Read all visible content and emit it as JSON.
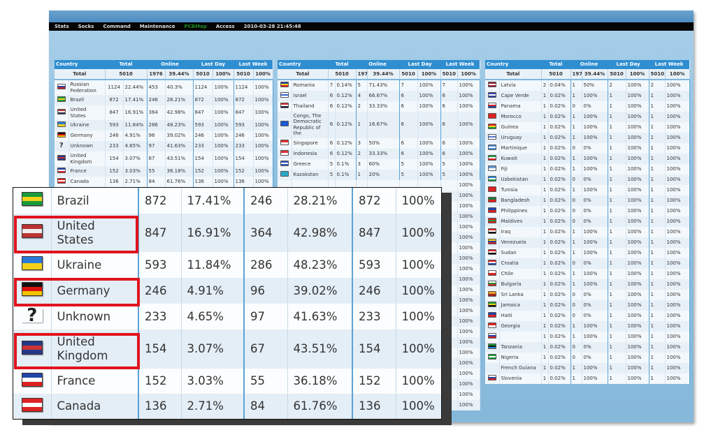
{
  "nav": {
    "items": [
      "Stats",
      "Socks",
      "Command",
      "Maintenance",
      "PCBMap",
      "Access"
    ],
    "active": "PCBMap",
    "datetime": "2010-03-28 21:45:48"
  },
  "headers": {
    "country": "Country",
    "total": "Total",
    "online": "Online",
    "last_day": "Last Day",
    "last_week": "Last Week"
  },
  "totals": {
    "label": "Total",
    "total": "5010",
    "online": "1976",
    "online_pct": "39.44%",
    "last_day": "5010",
    "last_day_pct": "100%",
    "last_week": "5010",
    "last_week_pct": "100%"
  },
  "colors": {
    "accent": "#2f8ed0",
    "highlight": "#e0141e",
    "active_nav": "#1d8a1d"
  },
  "tables": [
    [
      {
        "name": "Russian Federation",
        "flag": [
          "#fff",
          "#2244aa",
          "#cc2222"
        ],
        "v": [
          "1124",
          "22.44%",
          "453",
          "40.3%",
          "1124",
          "100%",
          "1124",
          "100%"
        ]
      },
      {
        "name": "Brazil",
        "flag": [
          "#1a9a3a",
          "#f2d21a",
          "#1a9a3a"
        ],
        "v": [
          "872",
          "17.41%",
          "246",
          "28.21%",
          "872",
          "100%",
          "872",
          "100%"
        ]
      },
      {
        "name": "United States",
        "flag": [
          "#b33",
          "#eee",
          "#335"
        ],
        "v": [
          "847",
          "16.91%",
          "364",
          "42.98%",
          "847",
          "100%",
          "847",
          "100%"
        ]
      },
      {
        "name": "Ukraine",
        "flag": [
          "#2a7bd8",
          "#f5d21a"
        ],
        "v": [
          "593",
          "11.84%",
          "286",
          "48.23%",
          "593",
          "100%",
          "593",
          "100%"
        ]
      },
      {
        "name": "Germany",
        "flag": [
          "#111",
          "#d11",
          "#f5c400"
        ],
        "v": [
          "246",
          "4.91%",
          "96",
          "39.02%",
          "246",
          "100%",
          "246",
          "100%"
        ]
      },
      {
        "name": "Unknown",
        "flag": null,
        "v": [
          "233",
          "4.65%",
          "97",
          "41.63%",
          "233",
          "100%",
          "233",
          "100%"
        ]
      },
      {
        "name": "United Kingdom",
        "flag": [
          "#233a8a",
          "#c33",
          "#233a8a"
        ],
        "v": [
          "154",
          "3.07%",
          "67",
          "43.51%",
          "154",
          "100%",
          "154",
          "100%"
        ]
      },
      {
        "name": "France",
        "flag": [
          "#2244aa",
          "#fff",
          "#d22"
        ],
        "v": [
          "152",
          "3.03%",
          "55",
          "36.18%",
          "152",
          "100%",
          "152",
          "100%"
        ]
      },
      {
        "name": "Canada",
        "flag": [
          "#d22",
          "#fff",
          "#d22"
        ],
        "v": [
          "136",
          "2.71%",
          "84",
          "61.76%",
          "136",
          "100%",
          "136",
          "100%"
        ]
      }
    ],
    [
      {
        "name": "Romania",
        "flag": [
          "#2244aa",
          "#f5d21a",
          "#d22"
        ],
        "v": [
          "7",
          "0.14%",
          "5",
          "71.43%",
          "7",
          "100%",
          "7",
          "100%"
        ]
      },
      {
        "name": "Israel",
        "flag": [
          "#fff",
          "#3366cc",
          "#fff"
        ],
        "v": [
          "6",
          "0.12%",
          "4",
          "66.67%",
          "6",
          "100%",
          "6",
          "100%"
        ]
      },
      {
        "name": "Thailand",
        "flag": [
          "#c33",
          "#fff",
          "#224"
        ],
        "v": [
          "6",
          "0.12%",
          "2",
          "33.33%",
          "6",
          "100%",
          "6",
          "100%"
        ]
      },
      {
        "name": "Congo, The Democratic Republic of the",
        "flag": [
          "#1a5ad8",
          "#1a5ad8"
        ],
        "v": [
          "6",
          "0.12%",
          "1",
          "16.67%",
          "6",
          "100%",
          "6",
          "100%"
        ]
      },
      {
        "name": "Singapore",
        "flag": [
          "#d33",
          "#fff"
        ],
        "v": [
          "6",
          "0.12%",
          "3",
          "50%",
          "6",
          "100%",
          "6",
          "100%"
        ]
      },
      {
        "name": "Indonesia",
        "flag": [
          "#d33",
          "#fff"
        ],
        "v": [
          "6",
          "0.12%",
          "2",
          "33.33%",
          "6",
          "100%",
          "6",
          "100%"
        ]
      },
      {
        "name": "Greece",
        "flag": [
          "#3355bb",
          "#fff",
          "#3355bb"
        ],
        "v": [
          "5",
          "0.1%",
          "3",
          "60%",
          "5",
          "100%",
          "5",
          "100%"
        ]
      },
      {
        "name": "Kazakstan",
        "flag": [
          "#2aa8c8",
          "#2aa8c8"
        ],
        "v": [
          "5",
          "0.1%",
          "1",
          "20%",
          "5",
          "100%",
          "5",
          "100%"
        ]
      }
    ],
    [
      {
        "name": "Latvia",
        "flag": [
          "#9a2233",
          "#fff",
          "#9a2233"
        ],
        "v": [
          "2",
          "0.04%",
          "1",
          "50%",
          "2",
          "100%",
          "2",
          "100%"
        ]
      },
      {
        "name": "Cape Verde",
        "flag": [
          "#3344aa",
          "#fff",
          "#3344aa"
        ],
        "v": [
          "1",
          "0.02%",
          "1",
          "100%",
          "1",
          "100%",
          "1",
          "100%"
        ]
      },
      {
        "name": "Panama",
        "flag": [
          "#fff",
          "#d22",
          "#2244aa"
        ],
        "v": [
          "1",
          "0.02%",
          "0",
          "0%",
          "1",
          "100%",
          "1",
          "100%"
        ]
      },
      {
        "name": "Morocco",
        "flag": [
          "#d22",
          "#d22"
        ],
        "v": [
          "1",
          "0.02%",
          "1",
          "100%",
          "1",
          "100%",
          "1",
          "100%"
        ]
      },
      {
        "name": "Guinea",
        "flag": [
          "#d22",
          "#f5d21a",
          "#1a9a3a"
        ],
        "v": [
          "1",
          "0.02%",
          "1",
          "100%",
          "1",
          "100%",
          "1",
          "100%"
        ]
      },
      {
        "name": "Uruguay",
        "flag": [
          "#fff",
          "#5577cc",
          "#fff"
        ],
        "v": [
          "1",
          "0.02%",
          "1",
          "100%",
          "1",
          "100%",
          "1",
          "100%"
        ]
      },
      {
        "name": "Martinique",
        "flag": [
          "#4a8ad8",
          "#fff",
          "#4a8ad8"
        ],
        "v": [
          "1",
          "0.02%",
          "0",
          "0%",
          "1",
          "100%",
          "1",
          "100%"
        ]
      },
      {
        "name": "Kuwait",
        "flag": [
          "#1a9a3a",
          "#fff",
          "#d22"
        ],
        "v": [
          "1",
          "0.02%",
          "1",
          "100%",
          "1",
          "100%",
          "1",
          "100%"
        ]
      },
      {
        "name": "Fiji",
        "flag": [
          "#6a9ad8",
          "#fff"
        ],
        "v": [
          "1",
          "0.02%",
          "1",
          "100%",
          "1",
          "100%",
          "1",
          "100%"
        ]
      },
      {
        "name": "Uzbekistan",
        "flag": [
          "#2a8ad8",
          "#fff",
          "#1a9a3a"
        ],
        "v": [
          "1",
          "0.02%",
          "0",
          "0%",
          "1",
          "100%",
          "1",
          "100%"
        ]
      },
      {
        "name": "Tunisia",
        "flag": [
          "#d22",
          "#d22"
        ],
        "v": [
          "1",
          "0.02%",
          "1",
          "100%",
          "1",
          "100%",
          "1",
          "100%"
        ]
      },
      {
        "name": "Bangladesh",
        "flag": [
          "#1a7a3a",
          "#d22"
        ],
        "v": [
          "1",
          "0.02%",
          "0",
          "0%",
          "1",
          "100%",
          "1",
          "100%"
        ]
      },
      {
        "name": "Philippines",
        "flag": [
          "#2244aa",
          "#d22"
        ],
        "v": [
          "1",
          "0.02%",
          "0",
          "0%",
          "1",
          "100%",
          "1",
          "100%"
        ]
      },
      {
        "name": "Maldives",
        "flag": [
          "#d22",
          "#1a9a3a",
          "#d22"
        ],
        "v": [
          "1",
          "0.02%",
          "0",
          "0%",
          "1",
          "100%",
          "1",
          "100%"
        ]
      },
      {
        "name": "Iraq",
        "flag": [
          "#d22",
          "#fff",
          "#111"
        ],
        "v": [
          "1",
          "0.02%",
          "1",
          "100%",
          "1",
          "100%",
          "1",
          "100%"
        ]
      },
      {
        "name": "Venezuela",
        "flag": [
          "#f5d21a",
          "#2244aa",
          "#d22"
        ],
        "v": [
          "1",
          "0.02%",
          "1",
          "100%",
          "1",
          "100%",
          "1",
          "100%"
        ]
      },
      {
        "name": "Sudan",
        "flag": [
          "#d22",
          "#fff",
          "#111"
        ],
        "v": [
          "1",
          "0.02%",
          "1",
          "100%",
          "1",
          "100%",
          "1",
          "100%"
        ]
      },
      {
        "name": "Croatia",
        "flag": [
          "#d22",
          "#fff",
          "#2244aa"
        ],
        "v": [
          "1",
          "0.02%",
          "0",
          "0%",
          "1",
          "100%",
          "1",
          "100%"
        ]
      },
      {
        "name": "Chile",
        "flag": [
          "#fff",
          "#d22"
        ],
        "v": [
          "1",
          "0.02%",
          "1",
          "100%",
          "1",
          "100%",
          "1",
          "100%"
        ]
      },
      {
        "name": "Bulgaria",
        "flag": [
          "#fff",
          "#1a9a3a",
          "#d22"
        ],
        "v": [
          "1",
          "0.02%",
          "1",
          "100%",
          "1",
          "100%",
          "1",
          "100%"
        ]
      },
      {
        "name": "Sri Lanka",
        "flag": [
          "#e8a020",
          "#a02020"
        ],
        "v": [
          "1",
          "0.02%",
          "0",
          "0%",
          "1",
          "100%",
          "1",
          "100%"
        ]
      },
      {
        "name": "Jamaica",
        "flag": [
          "#1a9a3a",
          "#f5d21a",
          "#111"
        ],
        "v": [
          "1",
          "0.02%",
          "0",
          "0%",
          "1",
          "100%",
          "1",
          "100%"
        ]
      },
      {
        "name": "Haiti",
        "flag": [
          "#2244aa",
          "#d22"
        ],
        "v": [
          "1",
          "0.02%",
          "0",
          "0%",
          "1",
          "100%",
          "1",
          "100%"
        ]
      },
      {
        "name": "Georgia",
        "flag": [
          "#d22",
          "#fff"
        ],
        "v": [
          "1",
          "0.02%",
          "1",
          "100%",
          "1",
          "100%",
          "1",
          "100%"
        ]
      },
      {
        "name": "",
        "flag": [
          "#fff",
          "#2244aa",
          "#d22"
        ],
        "v": [
          "1",
          "0.02%",
          "1",
          "100%",
          "1",
          "100%",
          "1",
          "100%"
        ]
      },
      {
        "name": "Tanzania",
        "flag": [
          "#1a9a3a",
          "#111",
          "#2a8ad8"
        ],
        "v": [
          "1",
          "0.02%",
          "0",
          "0%",
          "1",
          "100%",
          "1",
          "100%"
        ]
      },
      {
        "name": "Nigeria",
        "flag": [
          "#1a9a3a",
          "#fff",
          "#1a9a3a"
        ],
        "v": [
          "1",
          "0.02%",
          "0",
          "0%",
          "1",
          "100%",
          "1",
          "100%"
        ]
      },
      {
        "name": "French Guiana",
        "flag": null,
        "v": [
          "1",
          "0.02%",
          "1",
          "100%",
          "1",
          "100%",
          "1",
          "100%"
        ]
      },
      {
        "name": "Slovenia",
        "flag": [
          "#fff",
          "#2244aa",
          "#d22"
        ],
        "v": [
          "1",
          "0.02%",
          "1",
          "100%",
          "1",
          "100%",
          "1",
          "100%"
        ]
      }
    ]
  ],
  "middle_obscured_last_week_pct": [
    "100%",
    "100%",
    "100%",
    "100%",
    "100%",
    "100%",
    "100%",
    "100%",
    "100%",
    "100%",
    "100%",
    "100%",
    "100%",
    "100%",
    "100%",
    "100%",
    "100%",
    "100%",
    "100%",
    "100%",
    "100%",
    "100%"
  ],
  "zoom_callout": {
    "highlighted": [
      "United States",
      "Germany",
      "United Kingdom"
    ],
    "rows": [
      {
        "name": "Brazil",
        "flag": [
          "#1a9a3a",
          "#f2d21a",
          "#1a9a3a"
        ],
        "v": [
          "872",
          "17.41%",
          "246",
          "28.21%",
          "872",
          "100%"
        ]
      },
      {
        "name": "United States",
        "flag": [
          "#b33",
          "#eee",
          "#b33"
        ],
        "v": [
          "847",
          "16.91%",
          "364",
          "42.98%",
          "847",
          "100%"
        ]
      },
      {
        "name": "Ukraine",
        "flag": [
          "#2a7bd8",
          "#f5d21a"
        ],
        "v": [
          "593",
          "11.84%",
          "286",
          "48.23%",
          "593",
          "100%"
        ]
      },
      {
        "name": "Germany",
        "flag": [
          "#111",
          "#d11",
          "#f5c400"
        ],
        "v": [
          "246",
          "4.91%",
          "96",
          "39.02%",
          "246",
          "100%"
        ]
      },
      {
        "name": "Unknown",
        "flag": null,
        "v": [
          "233",
          "4.65%",
          "97",
          "41.63%",
          "233",
          "100%"
        ]
      },
      {
        "name": "United Kingdom",
        "flag": [
          "#233a8a",
          "#c33",
          "#233a8a"
        ],
        "v": [
          "154",
          "3.07%",
          "67",
          "43.51%",
          "154",
          "100%"
        ]
      },
      {
        "name": "France",
        "flag": [
          "#2244aa",
          "#fff",
          "#d22"
        ],
        "v": [
          "152",
          "3.03%",
          "55",
          "36.18%",
          "152",
          "100%"
        ]
      },
      {
        "name": "Canada",
        "flag": [
          "#d22",
          "#fff",
          "#d22"
        ],
        "v": [
          "136",
          "2.71%",
          "84",
          "61.76%",
          "136",
          "100%"
        ]
      }
    ]
  }
}
